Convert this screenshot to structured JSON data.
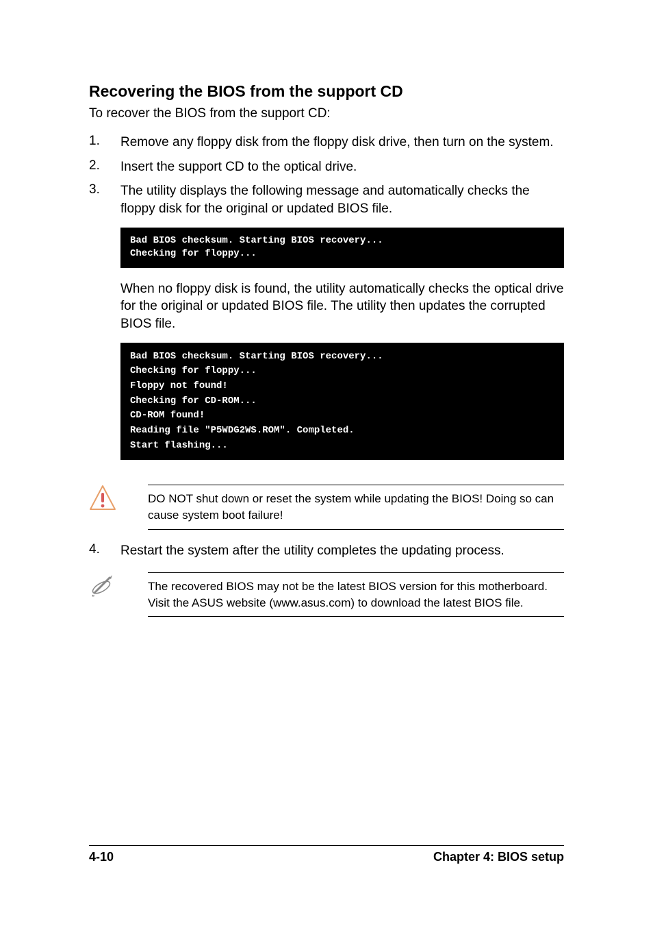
{
  "heading": "Recovering the BIOS from the support CD",
  "intro": "To recover the BIOS from the support CD:",
  "steps": {
    "s1": {
      "num": "1.",
      "text": "Remove any floppy disk from the floppy disk drive, then turn on the system."
    },
    "s2": {
      "num": "2.",
      "text": "Insert the support CD to the optical drive."
    },
    "s3": {
      "num": "3.",
      "text": "The utility displays the following message and automatically checks the floppy disk for the original or updated BIOS file."
    },
    "s3_code1": "Bad BIOS checksum. Starting BIOS recovery...\nChecking for floppy...",
    "s3_after": "When no floppy disk is found, the utility automatically checks the optical drive for the original or updated BIOS file. The utility then updates the corrupted BIOS file.",
    "s3_code2": "Bad BIOS checksum. Starting BIOS recovery...\nChecking for floppy...\nFloppy not found!\nChecking for CD-ROM...\nCD-ROM found!\nReading file \"P5WDG2WS.ROM\". Completed.\nStart flashing...",
    "s4": {
      "num": "4.",
      "text": "Restart the system after the utility completes the updating process."
    }
  },
  "warning": "DO NOT shut down or reset the system while updating the BIOS! Doing so can cause system boot failure!",
  "note": "The recovered BIOS may not be the latest BIOS version for this motherboard. Visit the ASUS website (www.asus.com) to download the latest BIOS file.",
  "footer": {
    "left": "4-10",
    "right": "Chapter 4: BIOS setup"
  }
}
